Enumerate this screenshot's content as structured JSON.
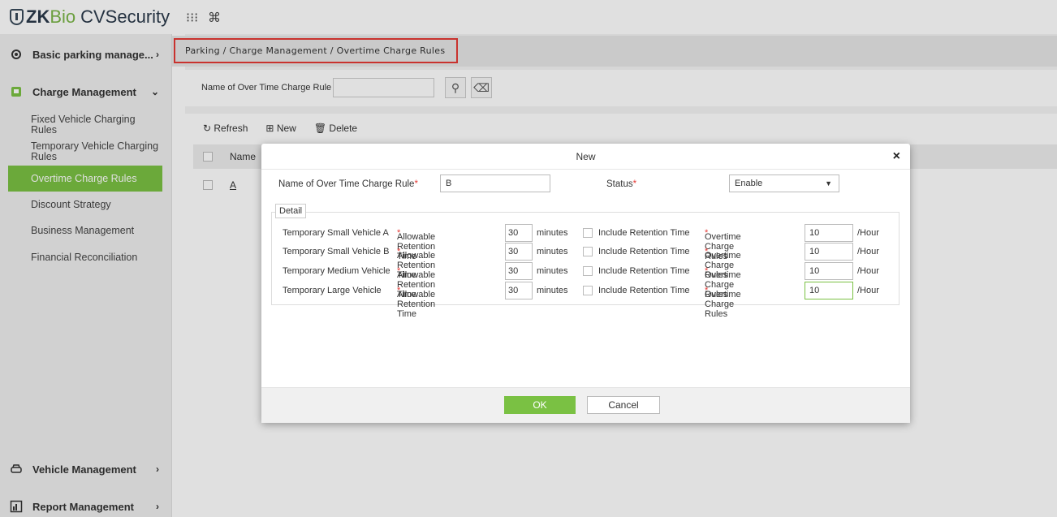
{
  "app": {
    "logo_zk": "ZK",
    "logo_bio": "Bio",
    "logo_cvs": "CVSecurity",
    "icons": [
      "grid-icon",
      "command-icon"
    ]
  },
  "sidebar": {
    "top_items": [
      {
        "label": "Basic parking manage...",
        "icon": "parking-settings-icon",
        "arrow": "›"
      },
      {
        "label": "Charge Management",
        "icon": "charge-icon",
        "arrow": "⌄"
      }
    ],
    "sub_items": [
      {
        "label": "Fixed Vehicle Charging Rules"
      },
      {
        "label": "Temporary Vehicle Charging Rules"
      },
      {
        "label": "Overtime Charge Rules",
        "active": true
      },
      {
        "label": "Discount Strategy"
      },
      {
        "label": "Business Management"
      },
      {
        "label": "Financial Reconciliation"
      }
    ],
    "bottom_items": [
      {
        "label": "Vehicle Management",
        "icon": "car-icon",
        "arrow": "›"
      },
      {
        "label": "Report Management",
        "icon": "report-icon",
        "arrow": "›"
      }
    ]
  },
  "breadcrumb": "Parking / Charge Management / Overtime Charge Rules",
  "filter": {
    "label": "Name of Over Time Charge Rule",
    "value": ""
  },
  "toolbar": {
    "refresh": "Refresh",
    "new": "New",
    "delete": "Delete"
  },
  "table": {
    "header_name": "Name",
    "rows": [
      {
        "name": "A"
      }
    ]
  },
  "dialog": {
    "title": "New",
    "name_label": "Name of Over Time Charge Rule",
    "name_value": "B",
    "status_label": "Status",
    "status_value": "Enable",
    "detail_legend": "Detail",
    "retention_label": "Allowable Retention Time",
    "minutes": "minutes",
    "include_label": "Include Retention Time",
    "rules_label": "Overtime Charge Rules",
    "per_hour": "/Hour",
    "rows": [
      {
        "vehicle": "Temporary Small Vehicle A",
        "retention": "30",
        "rule": "10"
      },
      {
        "vehicle": "Temporary Small Vehicle B",
        "retention": "30",
        "rule": "10"
      },
      {
        "vehicle": "Temporary Medium Vehicle",
        "retention": "30",
        "rule": "10"
      },
      {
        "vehicle": "Temporary Large Vehicle",
        "retention": "30",
        "rule": "10"
      }
    ],
    "ok": "OK",
    "cancel": "Cancel"
  },
  "colors": {
    "accent": "#7ac143",
    "highlight": "#e53935"
  }
}
